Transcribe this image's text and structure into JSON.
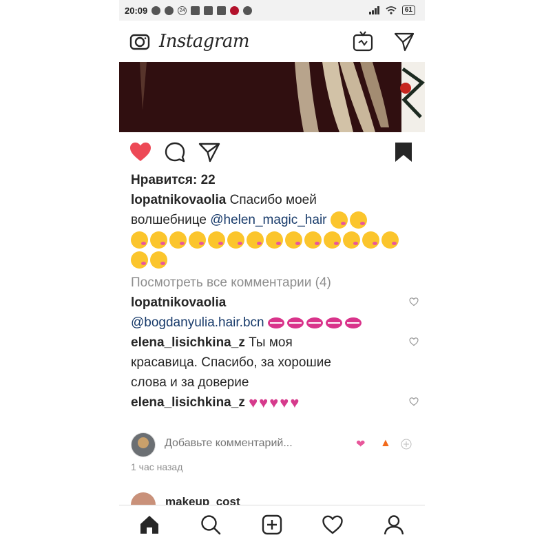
{
  "status_bar": {
    "time": "20:09",
    "notification_badge": "24",
    "battery": "61"
  },
  "header": {
    "logo_text": "Instagram",
    "icons": [
      "camera-icon",
      "igtv-icon",
      "direct-message-icon"
    ]
  },
  "post": {
    "liked": true,
    "saved": true,
    "likes_text": "Нравится: 22",
    "caption": {
      "username": "lopatnikovaolia",
      "text_line1": " Спасибо моей",
      "text_line2": "волшебнице ",
      "mention": "@helen_magic_hair",
      "emoji_name": "face-blowing-kiss",
      "emoji_count": 18
    },
    "view_all_comments": "Посмотреть все комментарии (4)",
    "comments": [
      {
        "username": "lopatnikovaolia",
        "mention": "@bogdanyulia.hair.bcn",
        "emoji_name": "kiss-mark",
        "emoji_count": 5
      },
      {
        "username": "elena_lisichkina_z",
        "text_line1": " Ты моя",
        "text_line2": "красавица. Спасибо, за хорошие",
        "text_line3": "слова и за доверие"
      },
      {
        "username": "elena_lisichkina_z",
        "emoji_name": "pink-heart",
        "emoji_count": 5
      }
    ],
    "add_comment_placeholder": "Добавьте комментарий...",
    "quick_reactions": [
      "heart-emoji",
      "fire-emoji"
    ],
    "time_ago": "1 час назад"
  },
  "next_post": {
    "username": "makeup_cost"
  },
  "bottom_nav": [
    "home-icon",
    "search-icon",
    "new-post-icon",
    "activity-icon",
    "profile-icon"
  ],
  "colors": {
    "like_red": "#ed4956",
    "mention_blue": "#173a6a",
    "secondary_text": "#8e8e8e"
  }
}
